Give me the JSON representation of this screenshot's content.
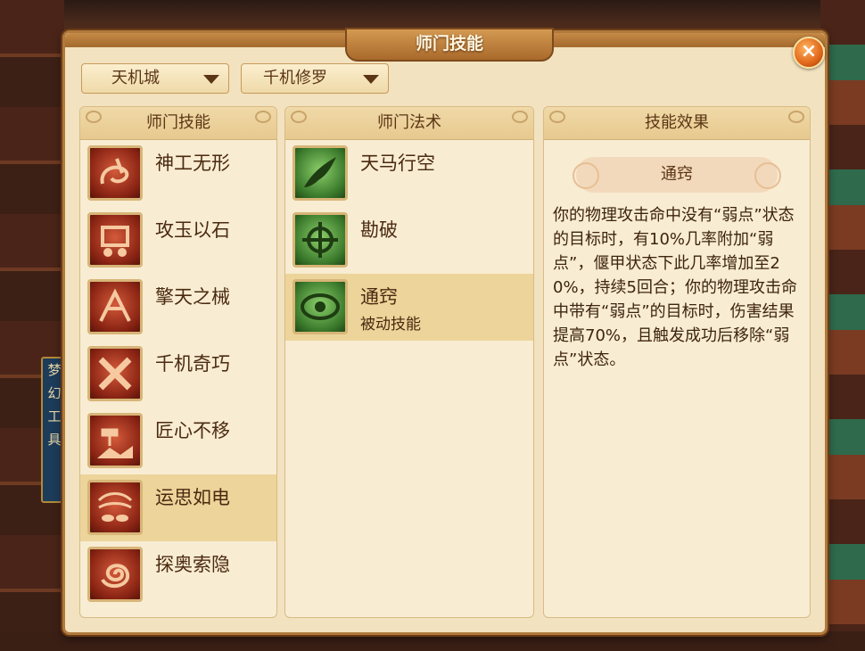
{
  "window": {
    "title": "师门技能",
    "close_label": "×"
  },
  "background": {
    "banner_chars": [
      "梦",
      "幻",
      "工",
      "具"
    ]
  },
  "filters": {
    "sect": {
      "value": "天机城"
    },
    "class": {
      "value": "千机修罗"
    }
  },
  "skills_panel": {
    "title": "师门技能",
    "items": [
      {
        "label": "神工无形",
        "icon": "spiral-trap-icon"
      },
      {
        "label": "攻玉以石",
        "icon": "mechanism-icon"
      },
      {
        "label": "擎天之械",
        "icon": "lift-arms-icon"
      },
      {
        "label": "千机奇巧",
        "icon": "crossed-beams-icon"
      },
      {
        "label": "匠心不移",
        "icon": "hammer-rock-icon"
      },
      {
        "label": "运思如电",
        "icon": "eye-storm-icon",
        "selected": true
      },
      {
        "label": "探奥索隐",
        "icon": "vortex-icon"
      }
    ]
  },
  "spells_panel": {
    "title": "师门法术",
    "items": [
      {
        "label": "天马行空",
        "icon": "winged-horse-icon"
      },
      {
        "label": "勘破",
        "icon": "crosshair-icon"
      },
      {
        "label": "通窍",
        "sub": "被动技能",
        "icon": "all-seeing-eye-icon",
        "selected": true
      }
    ]
  },
  "effect_panel": {
    "title": "技能效果",
    "skill_name": "通窍",
    "description": "你的物理攻击命中没有“弱点”状态的目标时，有10%几率附加“弱点”，偃甲状态下此几率增加至20%，持续5回合；你的物理攻击命中带有“弱点”的目标时，伤害结果提高70%，且触发成功后移除“弱点”状态。"
  },
  "colors": {
    "accent": "#b07a3c",
    "selected_row": "#ecd49a",
    "close": "#e0661a"
  }
}
